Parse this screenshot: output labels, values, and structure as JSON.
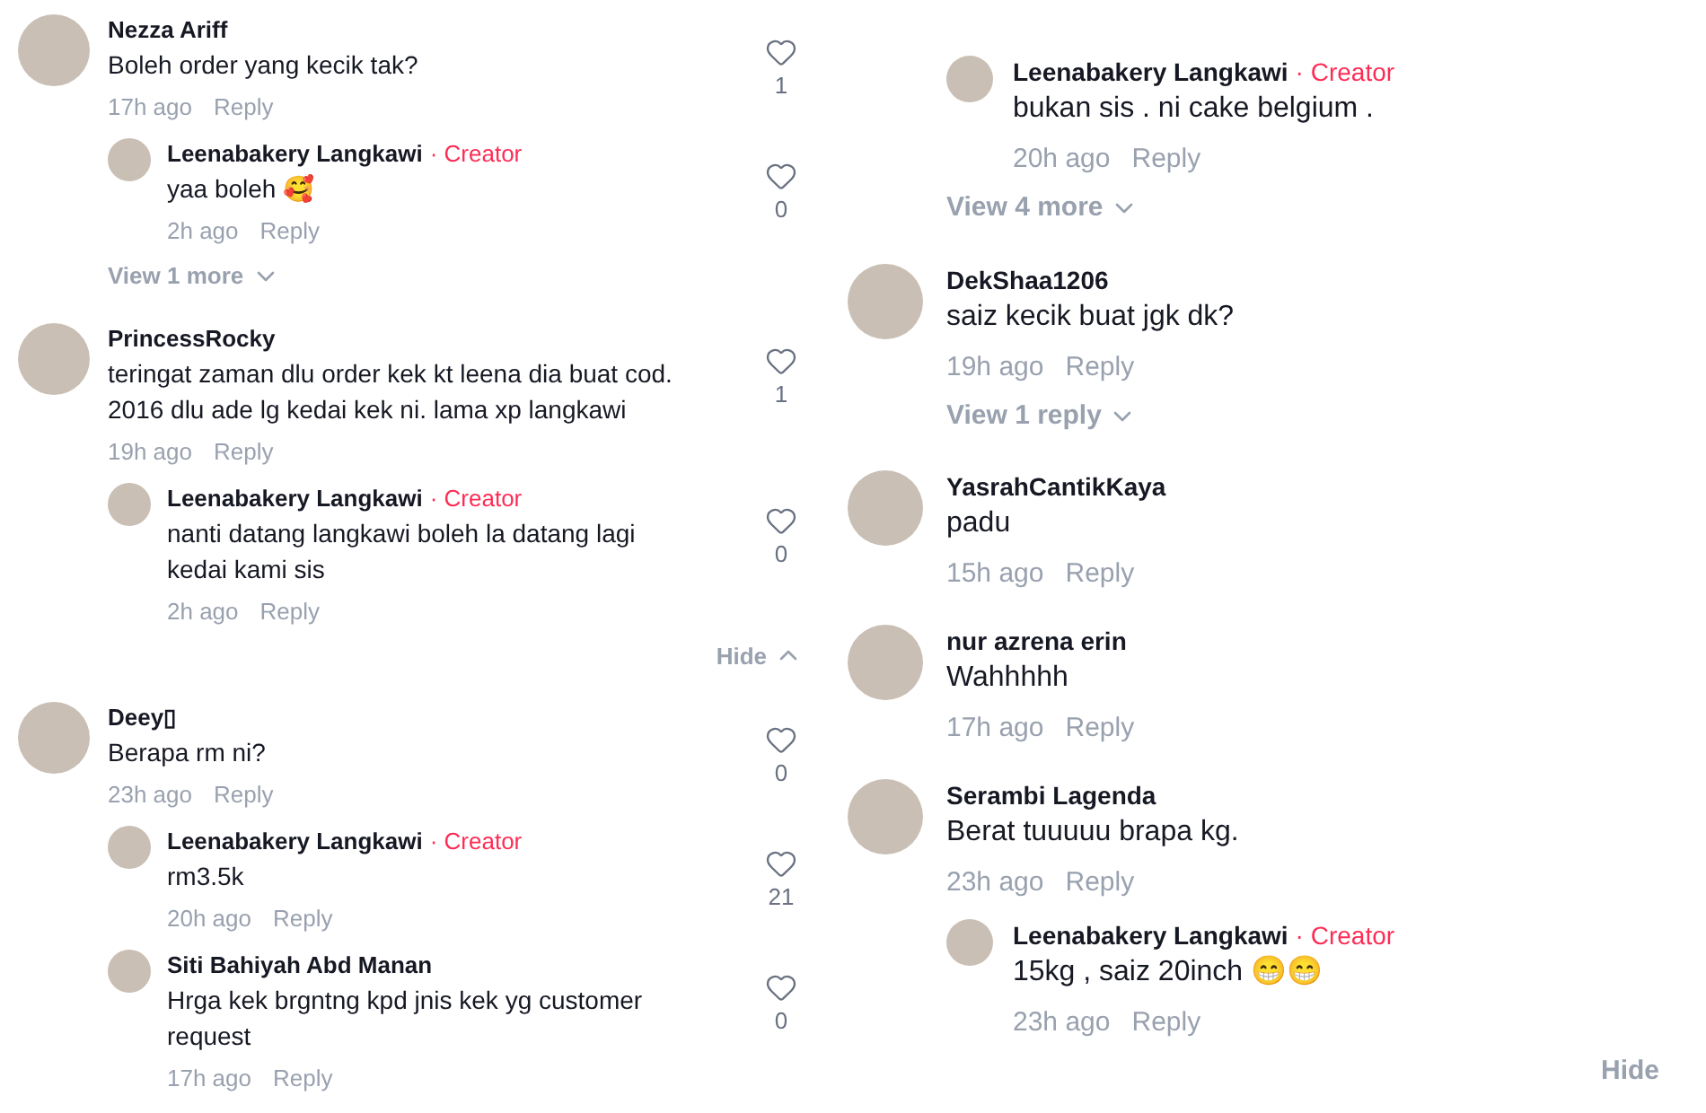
{
  "columns": [
    {
      "threads": [
        {
          "user": "Nezza Ariff",
          "text": "Boleh order yang kecik tak?",
          "time": "17h ago",
          "reply": "Reply",
          "likes": "1",
          "replies": [
            {
              "user": "Leenabakery Langkawi",
              "badge": "· Creator",
              "text": "yaa boleh 🥰",
              "time": "2h ago",
              "reply": "Reply",
              "likes": "0"
            }
          ],
          "more": {
            "kind": "view",
            "label": "View 1 more"
          }
        },
        {
          "user": "PrincessRocky",
          "text": "teringat zaman dlu order kek kt leena dia buat cod. 2016 dlu ade lg kedai kek ni. lama xp langkawi",
          "time": "19h ago",
          "reply": "Reply",
          "likes": "1",
          "replies": [
            {
              "user": "Leenabakery Langkawi",
              "badge": "· Creator",
              "text": "nanti datang langkawi boleh la datang lagi kedai kami sis",
              "time": "2h ago",
              "reply": "Reply",
              "likes": "0"
            }
          ],
          "more": {
            "kind": "hide",
            "label": "Hide"
          }
        },
        {
          "user": "Deey▯",
          "text": "Berapa rm ni?",
          "time": "23h ago",
          "reply": "Reply",
          "likes": "0",
          "replies": [
            {
              "user": "Leenabakery Langkawi",
              "badge": "· Creator",
              "text": "rm3.5k",
              "time": "20h ago",
              "reply": "Reply",
              "likes": "21"
            },
            {
              "user": "Siti Bahiyah Abd Manan",
              "text": "Hrga kek brgntng kpd jnis kek yg customer request",
              "time": "17h ago",
              "reply": "Reply",
              "likes": "0"
            }
          ]
        }
      ]
    },
    {
      "threads": [
        {
          "replies": [
            {
              "user": "Leenabakery Langkawi",
              "badge": "· Creator",
              "text": "bukan sis . ni cake belgium .",
              "time": "20h ago",
              "reply": "Reply"
            }
          ],
          "more": {
            "kind": "view",
            "label": "View 4 more"
          }
        },
        {
          "user": "DekShaa1206",
          "text": "saiz kecik buat jgk dk?",
          "time": "19h ago",
          "reply": "Reply",
          "more": {
            "kind": "view",
            "label": "View 1 reply"
          }
        },
        {
          "user": "YasrahCantikKaya",
          "text": "padu",
          "time": "15h ago",
          "reply": "Reply"
        },
        {
          "user": "nur azrena erin",
          "text": "Wahhhhh",
          "time": "17h ago",
          "reply": "Reply"
        },
        {
          "user": "Serambi Lagenda",
          "text": "Berat tuuuuu brapa kg.",
          "time": "23h ago",
          "reply": "Reply",
          "replies": [
            {
              "user": "Leenabakery Langkawi",
              "badge": "· Creator",
              "text": "15kg , saiz 20inch 😁😁",
              "time": "23h ago",
              "reply": "Reply"
            }
          ],
          "more": {
            "kind": "hide",
            "label": "Hide"
          }
        }
      ]
    }
  ]
}
